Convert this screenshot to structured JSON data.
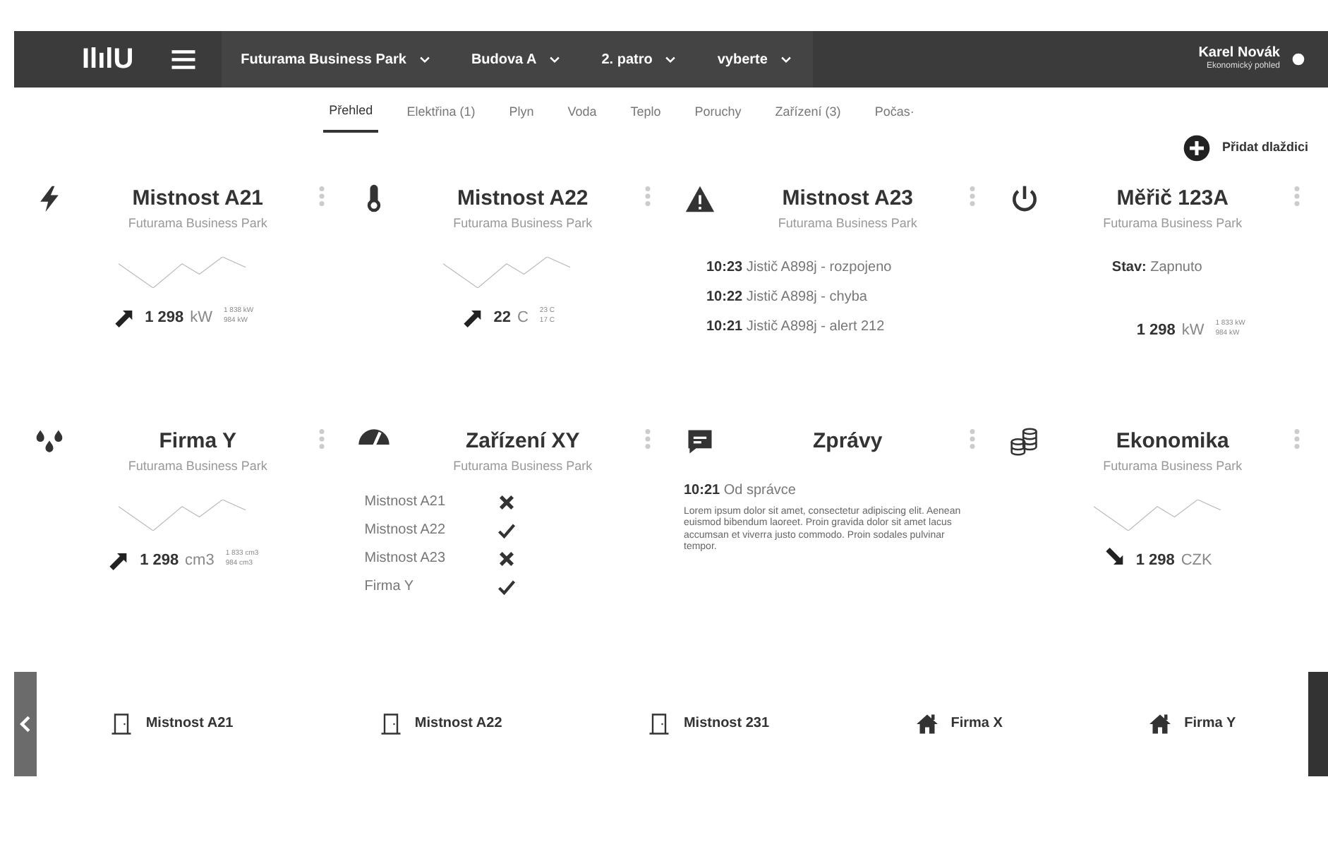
{
  "navbar": {
    "logo": "IlılU",
    "selectors": [
      {
        "label": "Futurama Business Park"
      },
      {
        "label": "Budova A"
      },
      {
        "label": "2. patro"
      },
      {
        "label": "vyberte"
      }
    ],
    "user": {
      "name": "Karel Novák",
      "role": "Ekonomický pohled"
    }
  },
  "tabs": [
    {
      "label": "Přehled",
      "selected": true
    },
    {
      "label": "Elektřina (1)",
      "selected": false
    },
    {
      "label": "Plyn",
      "selected": false
    },
    {
      "label": "Voda",
      "selected": false
    },
    {
      "label": "Teplo",
      "selected": false
    },
    {
      "label": "Poruchy",
      "selected": false
    },
    {
      "label": "Zařízení (3)",
      "selected": false
    },
    {
      "label": "Počas·",
      "selected": false
    }
  ],
  "add_tile": {
    "label": "Přidat dlaždici"
  },
  "tiles": [
    {
      "kind": "chart",
      "title": "Mistnost A21",
      "subtitle": "Futurama Business Park",
      "rising": true,
      "value": "1 298",
      "unit": "kW",
      "max": "1 838 kW",
      "min": "984 kW"
    },
    {
      "kind": "chart",
      "title": "Mistnost A22",
      "subtitle": "Futurama Business Park",
      "rising": true,
      "value": "22",
      "unit": "C",
      "max": "23 C",
      "min": "17 C"
    },
    {
      "kind": "alerts",
      "title": "Mistnost A23",
      "subtitle": "Futurama Business Park",
      "events": [
        {
          "time": "10:23",
          "text": "Jistič A898j - rozpojeno"
        },
        {
          "time": "10:22",
          "text": "Jistič A898j - chyba"
        },
        {
          "time": "10:21",
          "text": "Jistič A898j - alert 212"
        }
      ]
    },
    {
      "kind": "status",
      "title": "Měřič 123A",
      "subtitle": "Futurama Business Park",
      "status_label": "Stav:",
      "status_value": "Zapnuto",
      "value": "1 298",
      "unit": "kW",
      "max": "1 833 kW",
      "min": "984 kW"
    },
    {
      "kind": "chart",
      "title": "Firma Y",
      "subtitle": "Futurama Business Park",
      "rising": true,
      "value": "1 298",
      "unit": "cm3",
      "max": "1 833 cm3",
      "min": "984 cm3"
    },
    {
      "kind": "checklist",
      "title": "Zařízení XY",
      "subtitle": "Futurama Business Park",
      "items": [
        {
          "label": "Mistnost A21",
          "checked": false
        },
        {
          "label": "Mistnost A22",
          "checked": true
        },
        {
          "label": "Mistnost A23",
          "checked": false
        },
        {
          "label": "Firma Y",
          "checked": true
        }
      ]
    },
    {
      "kind": "messages",
      "title": "Zprávy",
      "time": "10:21",
      "from": "Od správce",
      "body": "Lorem ipsum dolor sit amet, consectetur adipiscing elit. Aenean euismod bibendum laoreet. Proin gravida dolor sit amet lacus accumsan et viverra justo commodo. Proin sodales pulvinar tempor."
    },
    {
      "kind": "chart",
      "title": "Ekonomika",
      "subtitle": "Futurama Business Park",
      "rising": false,
      "value": "1 298",
      "unit": "CZK"
    }
  ],
  "favorites": [
    {
      "kind": "room",
      "label": "Mistnost A21"
    },
    {
      "kind": "room",
      "label": "Mistnost A22"
    },
    {
      "kind": "room",
      "label": "Mistnost 231"
    },
    {
      "kind": "company",
      "label": "Firma X"
    },
    {
      "kind": "company",
      "label": "Firma Y"
    }
  ]
}
